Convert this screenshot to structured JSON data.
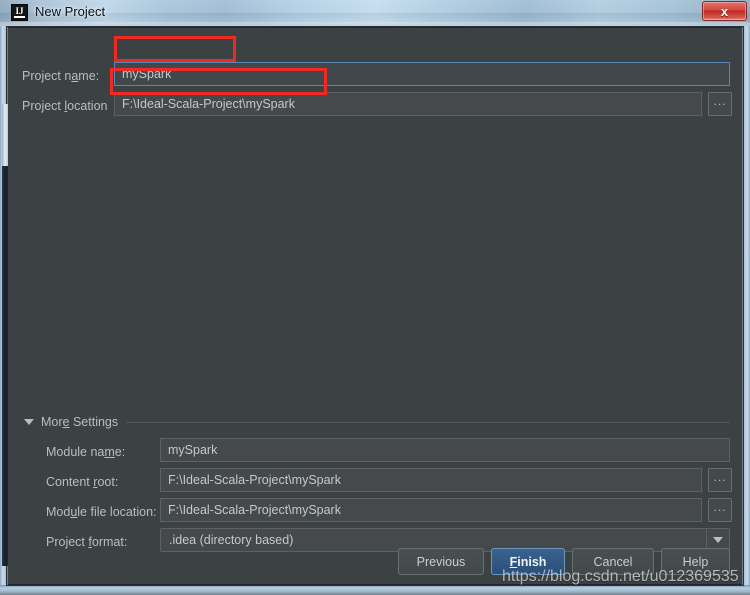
{
  "window": {
    "title": "New Project",
    "icon": "intellij-idea-logo",
    "close_label": "x"
  },
  "main": {
    "project_name": {
      "label_pre": "Project n",
      "label_mnemonic": "a",
      "label_post": "me:",
      "value": "mySpark"
    },
    "project_location": {
      "label_pre": "Project ",
      "label_mnemonic": "l",
      "label_post": "ocation",
      "value": "F:\\Ideal-Scala-Project\\mySpark",
      "browse_label": "..."
    }
  },
  "more_settings": {
    "title_pre": "Mor",
    "title_mnemonic": "e",
    "title_post": " Settings",
    "module_name": {
      "label_pre": "Module na",
      "label_mnemonic": "m",
      "label_post": "e:",
      "value": "mySpark"
    },
    "content_root": {
      "label_pre": "Content ",
      "label_mnemonic": "r",
      "label_post": "oot:",
      "value": "F:\\Ideal-Scala-Project\\mySpark",
      "browse_label": "..."
    },
    "module_file_location": {
      "label_pre": "Mod",
      "label_mnemonic": "u",
      "label_post": "le file location:",
      "value": "F:\\Ideal-Scala-Project\\mySpark",
      "browse_label": "..."
    },
    "project_format": {
      "label_pre": "Project ",
      "label_mnemonic": "f",
      "label_post": "ormat:",
      "value": ".idea (directory based)"
    }
  },
  "buttons": {
    "previous": "Previous",
    "finish_pre": "",
    "finish_mnemonic": "F",
    "finish_post": "inish",
    "cancel": "Cancel",
    "help": "Help"
  },
  "watermark": {
    "text": "https://blog.csdn.net/u012369535"
  },
  "colors": {
    "annotation": "#f02a22",
    "dialog_bg": "#3c4244",
    "field_bg": "#45494b",
    "focus_border": "#5b86b5",
    "default_button": "#2b4f78",
    "title_gradient": "#b3cfe4"
  }
}
